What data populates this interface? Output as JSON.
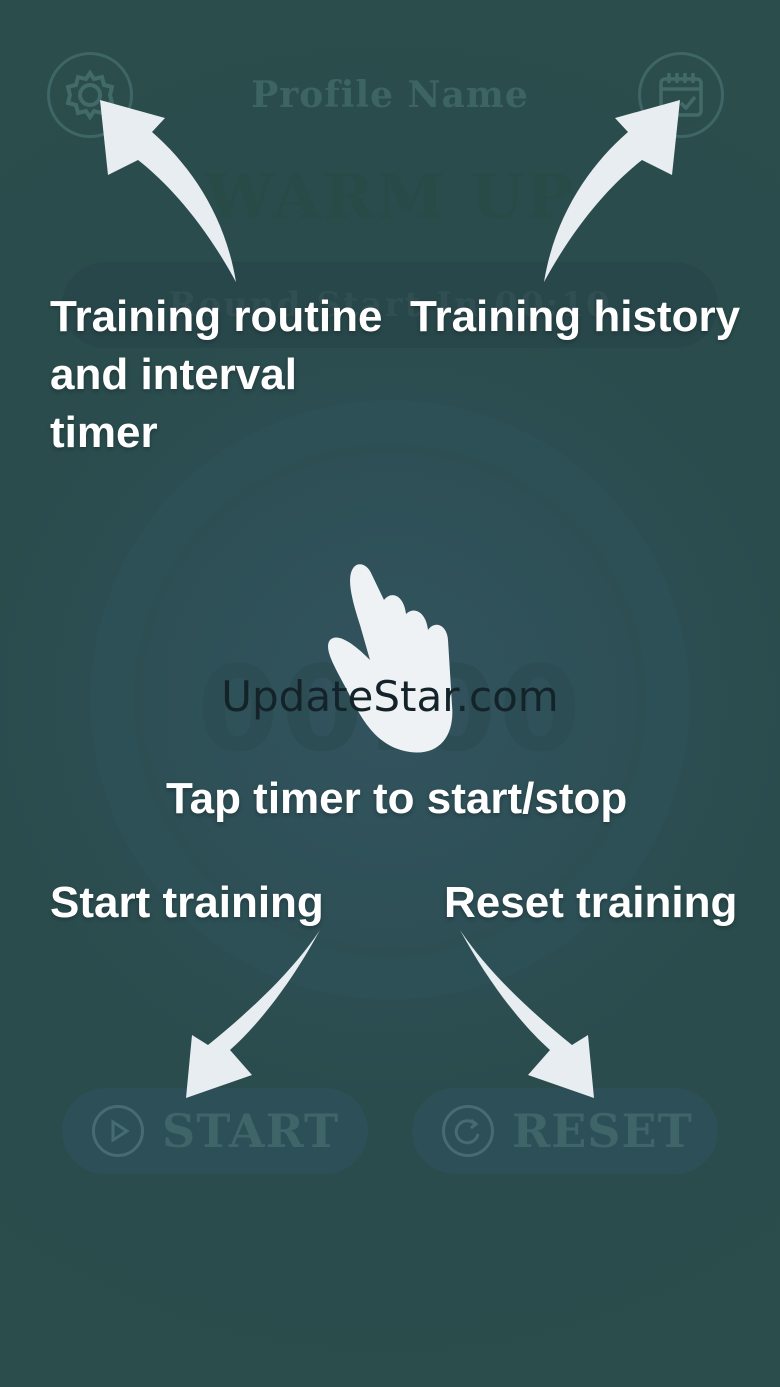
{
  "app": {
    "profile_name": "Profile Name",
    "phase_label": "WARM UP",
    "round_text": "Round Start In 00:10",
    "timer_value": "00:00",
    "start_label": "START",
    "reset_label": "RESET",
    "icons": {
      "settings": "gear-icon",
      "history": "calendar-icon",
      "start": "play-icon",
      "reset": "refresh-icon",
      "gesture": "tap-hand-icon"
    }
  },
  "overlay": {
    "routine_hint": [
      "Training routine",
      "and interval",
      "timer"
    ],
    "history_hint": "Training history",
    "tap_hint": "Tap timer to start/stop",
    "start_hint": "Start training",
    "reset_hint": "Reset training"
  },
  "watermark": "UpdateStar.com",
  "colors": {
    "background": "#2c4f4e",
    "overlay_text": "#ffffff",
    "arrow": "#e8edf2"
  }
}
